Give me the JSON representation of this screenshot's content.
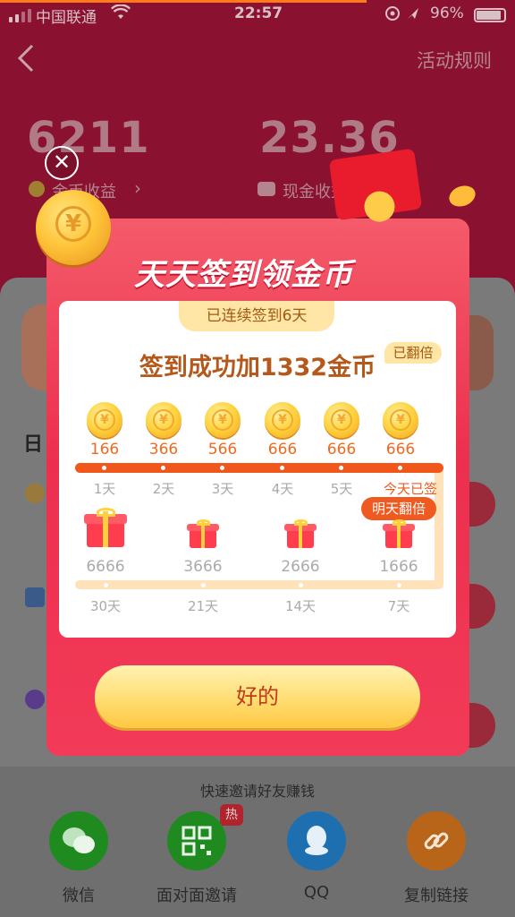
{
  "status_bar": {
    "carrier": "中国联通",
    "time": "22:57",
    "battery": "96%"
  },
  "header": {
    "rules_link": "活动规则"
  },
  "stats": {
    "coins_value": "6211",
    "coins_label": "金币收益",
    "cash_value": "23.36",
    "cash_label": "现金收益"
  },
  "page_bg": {
    "daily_label": "日"
  },
  "modal": {
    "title": "天天签到领金币",
    "streak_tag": "已连续签到6天",
    "doubled_tag": "已翻倍",
    "success_text": "签到成功加1332金币",
    "days": [
      {
        "label": "1天",
        "value": "166"
      },
      {
        "label": "2天",
        "value": "366"
      },
      {
        "label": "3天",
        "value": "566"
      },
      {
        "label": "4天",
        "value": "666"
      },
      {
        "label": "5天",
        "value": "666"
      },
      {
        "label": "今天已签",
        "value": "666"
      }
    ],
    "tomorrow_tag": "明天翻倍",
    "milestones": [
      {
        "label": "30天",
        "value": "6666"
      },
      {
        "label": "21天",
        "value": "3666"
      },
      {
        "label": "14天",
        "value": "2666"
      },
      {
        "label": "7天",
        "value": "1666"
      }
    ],
    "confirm_button": "好的"
  },
  "invite": {
    "hint": "快速邀请好友赚钱",
    "hot_badge": "热",
    "options": [
      {
        "label": "微信",
        "icon": "wechat-icon",
        "color": "#1f8a1f"
      },
      {
        "label": "面对面邀请",
        "icon": "qrcode-icon",
        "color": "#1f8a1f"
      },
      {
        "label": "QQ",
        "icon": "qq-icon",
        "color": "#1e6fb0"
      },
      {
        "label": "复制链接",
        "icon": "link-icon",
        "color": "#b8651a"
      }
    ]
  },
  "colors": {
    "modal_red": "#ec2f4e",
    "progress_orange": "#f1561a",
    "button_yellow": "#ffdd72"
  }
}
